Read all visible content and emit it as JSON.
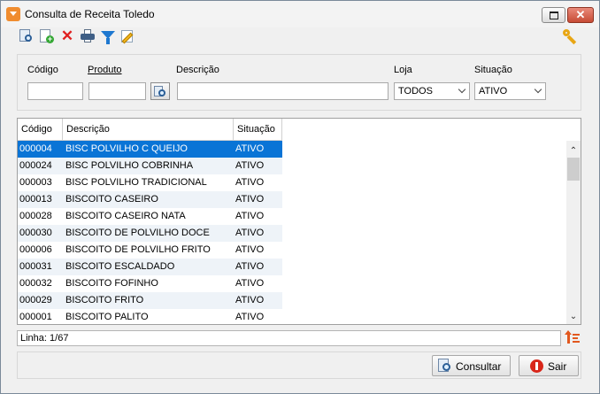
{
  "window": {
    "title": "Consulta de Receita Toledo"
  },
  "toolbar": {
    "icons": [
      "search-icon",
      "new-document-icon",
      "delete-icon",
      "print-icon",
      "filter-icon",
      "edit-icon",
      "key-icon"
    ]
  },
  "filters": {
    "codigo_label": "Código",
    "codigo_value": "",
    "produto_label": "Produto",
    "produto_value": "",
    "descricao_label": "Descrição",
    "descricao_value": "",
    "loja_label": "Loja",
    "loja_value": "TODOS",
    "situacao_label": "Situação",
    "situacao_value": "ATIVO"
  },
  "grid": {
    "columns": [
      "Código",
      "Descrição",
      "Situação"
    ],
    "rows": [
      {
        "codigo": "000004",
        "descricao": "BISC POLVILHO C QUEIJO",
        "situacao": "ATIVO"
      },
      {
        "codigo": "000024",
        "descricao": "BISC POLVILHO COBRINHA",
        "situacao": "ATIVO"
      },
      {
        "codigo": "000003",
        "descricao": "BISC POLVILHO TRADICIONAL",
        "situacao": "ATIVO"
      },
      {
        "codigo": "000013",
        "descricao": "BISCOITO CASEIRO",
        "situacao": "ATIVO"
      },
      {
        "codigo": "000028",
        "descricao": "BISCOITO CASEIRO NATA",
        "situacao": "ATIVO"
      },
      {
        "codigo": "000030",
        "descricao": "BISCOITO DE POLVILHO DOCE",
        "situacao": "ATIVO"
      },
      {
        "codigo": "000006",
        "descricao": "BISCOITO DE POLVILHO FRITO",
        "situacao": "ATIVO"
      },
      {
        "codigo": "000031",
        "descricao": "BISCOITO ESCALDADO",
        "situacao": "ATIVO"
      },
      {
        "codigo": "000032",
        "descricao": "BISCOITO FOFINHO",
        "situacao": "ATIVO"
      },
      {
        "codigo": "000029",
        "descricao": "BISCOITO FRITO",
        "situacao": "ATIVO"
      },
      {
        "codigo": "000001",
        "descricao": "BISCOITO PALITO",
        "situacao": "ATIVO"
      }
    ],
    "selected_index": 0
  },
  "status": {
    "text": "Linha: 1/67"
  },
  "buttons": {
    "consultar": "Consultar",
    "sair": "Sair"
  },
  "colors": {
    "selection": "#0a74d6",
    "accent": "#f08c2e"
  }
}
